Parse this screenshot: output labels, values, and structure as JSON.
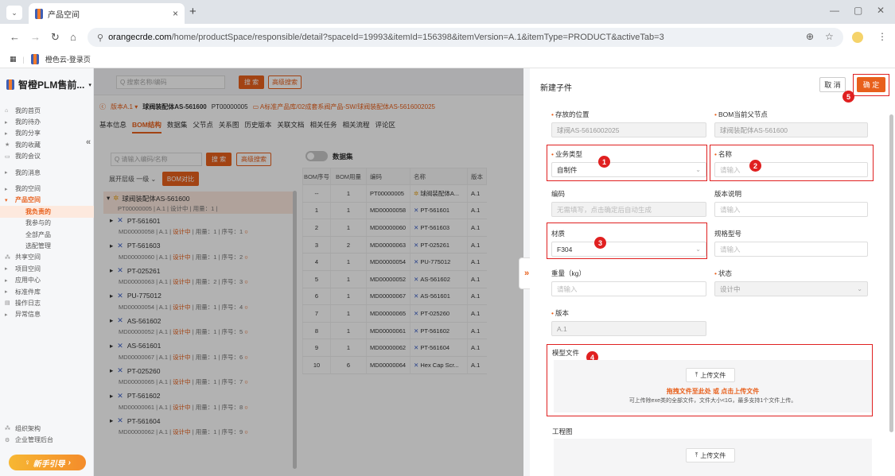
{
  "browser": {
    "tab_title": "产品空间",
    "url_host": "orangecrde.com",
    "url_path": "/home/productSpace/responsible/detail?spaceId=19993&itemId=156398&itemVersion=A.1&itemType=PRODUCT&activeTab=3",
    "bookmark": "橙色云-登录页"
  },
  "sidebar": {
    "brand": "智橙PLM售前...",
    "items": [
      {
        "label": "我的首页"
      },
      {
        "label": "我的待办"
      },
      {
        "label": "我的分享"
      },
      {
        "label": "我的收藏"
      },
      {
        "label": "我的会议"
      },
      {
        "label": "我的消息"
      },
      {
        "label": "我的空间"
      },
      {
        "label": "产品空间"
      },
      {
        "label": "我负责的"
      },
      {
        "label": "我参与的"
      },
      {
        "label": "全部产品"
      },
      {
        "label": "选配管理"
      },
      {
        "label": "共享空间"
      },
      {
        "label": "项目空间"
      },
      {
        "label": "应用中心"
      },
      {
        "label": "标准件库"
      },
      {
        "label": "操作日志"
      },
      {
        "label": "异常信息"
      }
    ],
    "bottom": [
      {
        "label": "组织架构"
      },
      {
        "label": "企业管理后台"
      }
    ],
    "guide": "新手引导"
  },
  "main": {
    "search_placeholder": "Q 搜索名称/编码",
    "search_btn": "搜 索",
    "adv_btn": "高级搜索",
    "crumb_version": "版本A.1 ▾",
    "crumb_name": "球阀装配体AS-561600",
    "crumb_code": "PT00000005",
    "crumb_path": "A标准产品库/02成套系阀产品-SW/球阀装配体AS-5616002025",
    "tabs": [
      "基本信息",
      "BOM结构",
      "数据集",
      "父节点",
      "关系图",
      "历史版本",
      "关联文档",
      "相关任务",
      "相关流程",
      "评论区"
    ],
    "tree_search_placeholder": "Q 请输入编码/名称",
    "tree_search_btn": "搜 索",
    "tree_adv_btn": "高级搜索",
    "expand_label": "展开层级  一级 ⌄",
    "bom_compare": "BOM对比",
    "dataset_label": "数据集"
  },
  "tree": {
    "root": {
      "name": "球阀装配体AS-561600",
      "meta": "PT00000005 | A.1 |  设计中  | 用量：1 |"
    },
    "nodes": [
      {
        "name": "PT-561601",
        "code": "MD00000058 | A.1 | ",
        "status": "设计中",
        "rest": " | 用量：1 | 序号：1"
      },
      {
        "name": "PT-561603",
        "code": "MD00000060 | A.1 | ",
        "status": "设计中",
        "rest": " | 用量：1 | 序号：2"
      },
      {
        "name": "PT-025261",
        "code": "MD00000063 | A.1 | ",
        "status": "设计中",
        "rest": " | 用量：2 | 序号：3"
      },
      {
        "name": "PU-775012",
        "code": "MD00000054 | A.1 | ",
        "status": "设计中",
        "rest": " | 用量：1 | 序号：4"
      },
      {
        "name": "AS-561602",
        "code": "MD00000052 | A.1 | ",
        "status": "设计中",
        "rest": " | 用量：1 | 序号：5"
      },
      {
        "name": "AS-561601",
        "code": "MD00000067 | A.1 | ",
        "status": "设计中",
        "rest": " | 用量：1 | 序号：6"
      },
      {
        "name": "PT-025260",
        "code": "MD00000065 | A.1 | ",
        "status": "设计中",
        "rest": " | 用量：1 | 序号：7"
      },
      {
        "name": "PT-561602",
        "code": "MD00000061 | A.1 | ",
        "status": "设计中",
        "rest": " | 用量：1 | 序号：8"
      },
      {
        "name": "PT-561604",
        "code": "MD00000062 | A.1 | ",
        "status": "设计中",
        "rest": " | 用量：1 | 序号：9"
      }
    ]
  },
  "grid": {
    "headers": [
      "BOM序号",
      "BOM用量",
      "编码",
      "名称",
      "版本"
    ],
    "rows": [
      [
        "--",
        "1",
        "PT00000005",
        "球阀装配体A...",
        "A.1"
      ],
      [
        "1",
        "1",
        "MD00000058",
        "PT-561601",
        "A.1"
      ],
      [
        "2",
        "1",
        "MD00000060",
        "PT-561603",
        "A.1"
      ],
      [
        "3",
        "2",
        "MD00000063",
        "PT-025261",
        "A.1"
      ],
      [
        "4",
        "1",
        "MD00000054",
        "PU-775012",
        "A.1"
      ],
      [
        "5",
        "1",
        "MD00000052",
        "AS-561602",
        "A.1"
      ],
      [
        "6",
        "1",
        "MD00000067",
        "AS-561601",
        "A.1"
      ],
      [
        "7",
        "1",
        "MD00000065",
        "PT-025260",
        "A.1"
      ],
      [
        "8",
        "1",
        "MD00000061",
        "PT-561602",
        "A.1"
      ],
      [
        "9",
        "1",
        "MD00000062",
        "PT-561604",
        "A.1"
      ],
      [
        "10",
        "6",
        "MD00000064",
        "Hex Cap Scr...",
        "A.1"
      ]
    ]
  },
  "drawer": {
    "title": "新建子件",
    "cancel": "取 消",
    "ok": "确 定",
    "location_label": "存放的位置",
    "location_value": "球阀AS-5616002025",
    "parent_label": "BOM当前父节点",
    "parent_value": "球阀装配体AS-561600",
    "biz_type_label": "业务类型",
    "biz_type_value": "自制件",
    "name_label": "名称",
    "name_placeholder": "请输入",
    "code_label": "编码",
    "code_placeholder": "无需填写，点击确定后自动生成",
    "version_note_label": "版本说明",
    "version_note_placeholder": "请输入",
    "material_label": "材质",
    "material_value": "F304",
    "spec_label": "规格型号",
    "spec_placeholder": "请输入",
    "weight_label": "重量（kg）",
    "weight_placeholder": "请输入",
    "status_label": "状态",
    "status_value": "设计中",
    "version_label": "版本",
    "version_value": "A.1",
    "model_file_label": "模型文件",
    "upload_btn": "上传文件",
    "upload_hint_main": "拖拽文件至此处 或 点击上传文件",
    "upload_hint_sub": "可上传除exe类的全部文件，文件大小<1G，最多支持1个文件上传。",
    "drawing_label": "工程图",
    "badges": [
      "1",
      "2",
      "3",
      "4",
      "5"
    ]
  },
  "colors": {
    "accent": "#e8601c",
    "annotation": "#e02020",
    "brand_blue": "#3f5fb4"
  }
}
